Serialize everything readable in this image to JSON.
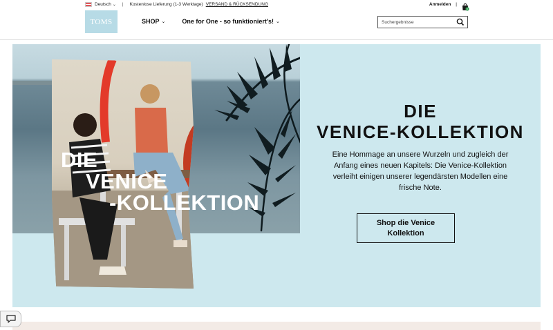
{
  "header": {
    "language": "Deutsch",
    "shipping_text": "Kostenlose Lieferung (1-3 Werktage)",
    "shipping_link": "VERSAND & RÜCKSENDUNG",
    "login": "Anmelden",
    "cart_count": "0",
    "logo": "TOMS",
    "nav": [
      {
        "label": "SHOP"
      },
      {
        "label": "One for One - so funktioniert's!"
      }
    ],
    "search_placeholder": "Suchergebnisse",
    "icons": [
      "chevron-down-icon",
      "shopping-bag-icon",
      "search-icon",
      "chat-icon"
    ],
    "colors": {
      "logo_bg": "#b7dbe6",
      "hero_bg": "#cde8ee",
      "bag": "#1a1a1a",
      "bag_badge": "#2e9a4f"
    }
  },
  "hero": {
    "photo_text": [
      "DIE",
      "VENICE",
      "-KOLLEKTION"
    ],
    "title_line1": "DIE",
    "title_line2": "VENICE-KOLLEKTION",
    "description": "Eine Hommage an unsere Wurzeln und zugleich der Anfang eines neuen Kapitels: Die Venice-Kollektion verleiht einigen unserer legendärsten Modellen eine frische Note.",
    "cta": "Shop die Venice Kollektion"
  }
}
